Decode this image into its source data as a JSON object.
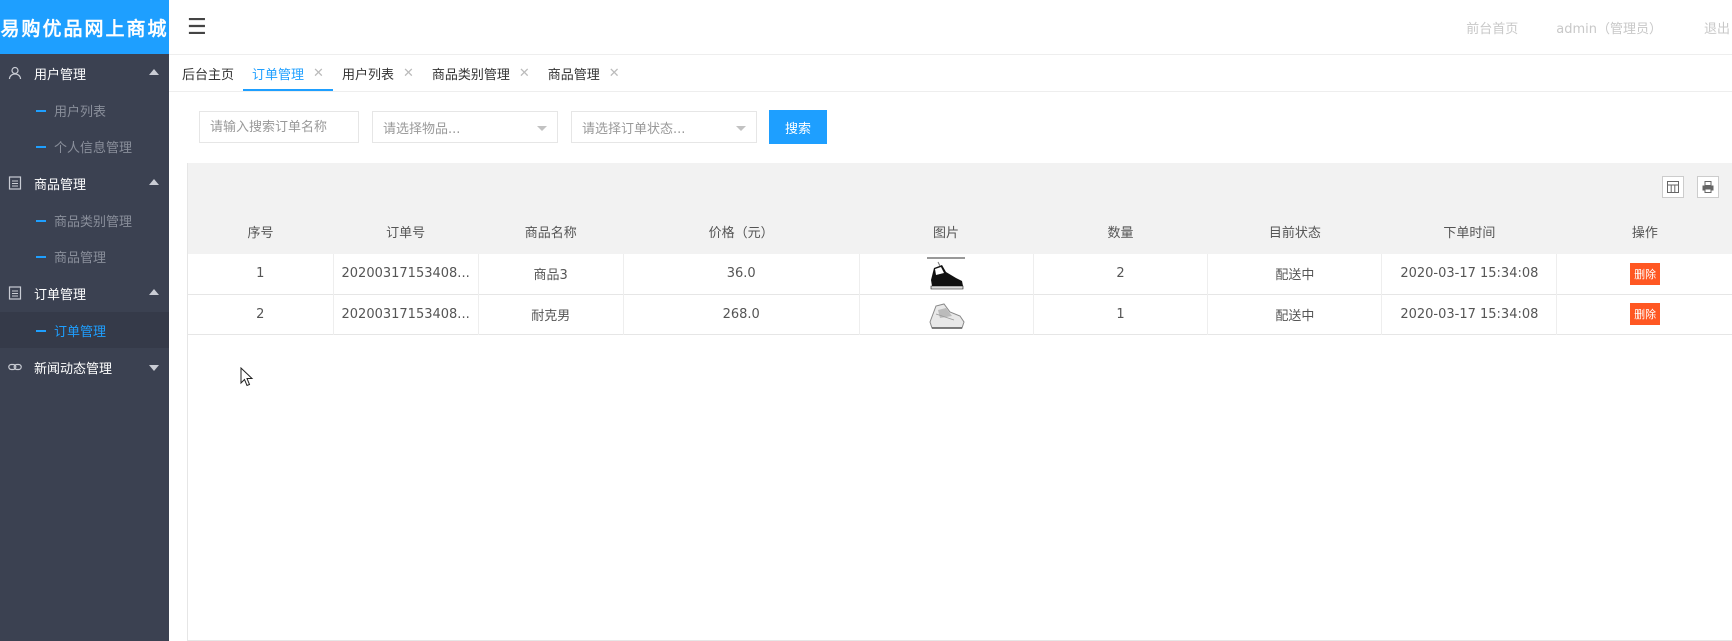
{
  "logo": {
    "text": "易购优品网上商城"
  },
  "sidebar": {
    "groups": [
      {
        "label": "用户管理",
        "icon": "user-icon",
        "expanded": true,
        "items": [
          {
            "label": "用户列表"
          },
          {
            "label": "个人信息管理"
          }
        ]
      },
      {
        "label": "商品管理",
        "icon": "document-icon",
        "expanded": true,
        "items": [
          {
            "label": "商品类别管理"
          },
          {
            "label": "商品管理"
          }
        ]
      },
      {
        "label": "订单管理",
        "icon": "document-icon",
        "expanded": true,
        "items": [
          {
            "label": "订单管理",
            "active": true
          }
        ]
      },
      {
        "label": "新闻动态管理",
        "icon": "link-icon",
        "expanded": false,
        "items": []
      }
    ]
  },
  "header": {
    "menu_icon": "☰",
    "home_link": "前台首页",
    "user": "admin（管理员）",
    "logout": "退出"
  },
  "tabs": [
    {
      "label": "后台主页",
      "closable": false
    },
    {
      "label": "订单管理",
      "closable": true,
      "active": true
    },
    {
      "label": "用户列表",
      "closable": true
    },
    {
      "label": "商品类别管理",
      "closable": true
    },
    {
      "label": "商品管理",
      "closable": true
    }
  ],
  "filters": {
    "search_placeholder": "请输入搜索订单名称",
    "goods_select": "请选择物品...",
    "status_select": "请选择订单状态...",
    "search_button": "搜索"
  },
  "table": {
    "columns": [
      "序号",
      "订单号",
      "商品名称",
      "价格（元）",
      "图片",
      "数量",
      "目前状态",
      "下单时间",
      "操作"
    ],
    "rows": [
      {
        "index": "1",
        "order_no": "20200317153408...",
        "name": "商品3",
        "price": "36.0",
        "image": "black-sneaker",
        "qty": "2",
        "status": "配送中",
        "time": "2020-03-17 15:34:08",
        "action": "删除"
      },
      {
        "index": "2",
        "order_no": "20200317153408...",
        "name": "耐克男",
        "price": "268.0",
        "image": "white-sneaker",
        "qty": "1",
        "status": "配送中",
        "time": "2020-03-17 15:34:08",
        "action": "删除"
      }
    ]
  },
  "colors": {
    "accent": "#1e9fff",
    "sidebar": "#3b4151",
    "danger": "#ff5722"
  }
}
